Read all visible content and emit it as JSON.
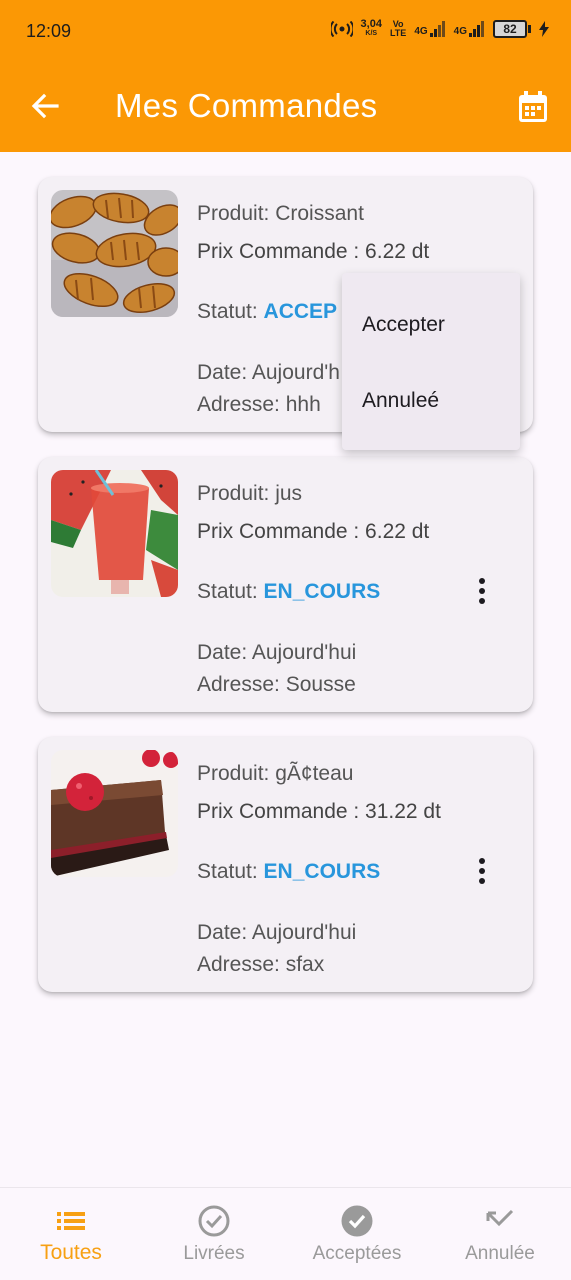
{
  "status_bar": {
    "time": "12:09",
    "speed_value": "3,04",
    "speed_unit": "K/S",
    "volte_top": "Vo",
    "volte_bottom": "LTE",
    "net1": "4G",
    "net2": "4G",
    "battery": "82"
  },
  "header": {
    "title": "Mes Commandes",
    "back_icon": "arrow-left-icon",
    "calendar_icon": "calendar-icon",
    "bar_color": "#fb9805"
  },
  "orders": [
    {
      "produit": "Produit: Croissant",
      "prix": "Prix Commande : 6.22 dt",
      "statut_label": "Statut: ",
      "statut_value": "ACCEP",
      "date": "Date: Aujourd'h",
      "adresse": "Adresse: hhh",
      "image": "croissants"
    },
    {
      "produit": "Produit: jus",
      "prix": "Prix Commande : 6.22 dt",
      "statut_label": "Statut: ",
      "statut_value": "EN_COURS",
      "date": "Date: Aujourd'hui",
      "adresse": "Adresse: Sousse",
      "image": "watermelon-juice"
    },
    {
      "produit": "Produit: gÃ¢teau",
      "prix": "Prix Commande : 31.22 dt",
      "statut_label": "Statut: ",
      "statut_value": "EN_COURS",
      "date": "Date: Aujourd'hui",
      "adresse": "Adresse: sfax",
      "image": "chocolate-raspberry-cake"
    }
  ],
  "popup_menu": {
    "items": [
      "Accepter",
      "Annuleé"
    ]
  },
  "bottom_nav": {
    "items": [
      {
        "label": "Toutes",
        "icon": "list-icon",
        "active": true
      },
      {
        "label": "Livrées",
        "icon": "check-circle-outline-icon",
        "active": false
      },
      {
        "label": "Acceptées",
        "icon": "check-circle-filled-icon",
        "active": false
      },
      {
        "label": "Annulée",
        "icon": "call-missed-icon",
        "active": false
      }
    ],
    "active_color": "#f7a013"
  },
  "colors": {
    "status_value": "#2896dc",
    "background": "#fcf7fd",
    "card": "#f4f0f5"
  }
}
